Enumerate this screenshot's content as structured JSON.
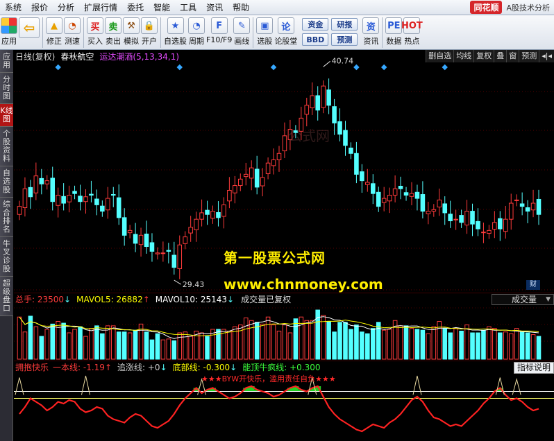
{
  "menu": [
    "系统",
    "报价",
    "分析",
    "扩展行情",
    "委托",
    "智能",
    "工具",
    "资讯",
    "帮助"
  ],
  "brand": {
    "logo": "同花顺",
    "title": "A股技术分析"
  },
  "toolbar": {
    "items": [
      {
        "label": "应用",
        "icon": "app-grid-icon"
      },
      {
        "label": "",
        "icon": "back-arrow-icon"
      },
      {
        "label": "修正",
        "icon": "correct-icon"
      },
      {
        "label": "测速",
        "icon": "speed-test-icon"
      },
      {
        "label": "买入",
        "icon": "buy-icon"
      },
      {
        "label": "卖出",
        "icon": "sell-icon"
      },
      {
        "label": "模拟",
        "icon": "simulate-icon"
      },
      {
        "label": "开户",
        "icon": "lock-icon"
      },
      {
        "label": "自选股",
        "icon": "star-icon"
      },
      {
        "label": "周期",
        "icon": "clock-icon"
      },
      {
        "label": "F10/F9",
        "icon": "f10-icon"
      },
      {
        "label": "画线",
        "icon": "draw-icon"
      },
      {
        "label": "选股",
        "icon": "select-stock-icon"
      },
      {
        "label": "论股堂",
        "icon": "forum-icon"
      },
      {
        "label": "资讯",
        "icon": "news-icon"
      },
      {
        "label": "数据",
        "icon": "data-icon"
      },
      {
        "label": "热点",
        "icon": "hot-icon"
      }
    ],
    "small": [
      "资金",
      "研报",
      "BBD",
      "预测"
    ],
    "icon_glyphs": {
      "up": "▲",
      "down": "▼",
      "buy": "买",
      "sell": "卖",
      "lock": "🔒",
      "star": "★",
      "clock": "◔",
      "draw": "✎",
      "pe": "PE",
      "hot": "HOT",
      "info": "资"
    }
  },
  "left_tabs": [
    "应用",
    "分时图",
    "K线图",
    "个股资料",
    "自选股",
    "综合排名",
    "牛叉诊股",
    "超级盘口"
  ],
  "chart_header": {
    "period": "日线(复权)",
    "stock": "春秋航空",
    "indicator": "运达潮酒(5,13,34,1)"
  },
  "right_controls": [
    "删自选",
    "均线",
    "复权",
    "叠",
    "窗",
    "预测"
  ],
  "price": {
    "high": "40.74",
    "low": "29.43"
  },
  "cai_label": "财",
  "volume_header": {
    "total": "总手: 23500",
    "mavol5": "MAVOL5: 26882",
    "mavol10": "MAVOL10: 25143",
    "adj": "成交量已复权",
    "selector": "成交量"
  },
  "indicator_header": {
    "name": "拥抱快乐",
    "l1": "一本线: -1.19",
    "l2": "追涨线: +0",
    "l3": "底部线: -0.300",
    "l4": "能顶牛疯线: +0.300",
    "explain": "指标说明"
  },
  "watermark": {
    "line1": "第一股票公式网",
    "line2": "www.chnmoney.com",
    "faint": "公式网"
  },
  "warning_text": "★★★BYW开快乐，滥用责任自负★★★",
  "colors": {
    "up": "#ff3b3b",
    "down": "#54ffff",
    "yellow": "#ffff00",
    "ma": "#e8e8e8"
  },
  "chart_data": [
    {
      "type": "candlestick",
      "title": "春秋航空 日线(复权)",
      "ylim": [
        28,
        42
      ],
      "annotations": [
        {
          "label": "40.74",
          "kind": "high"
        },
        {
          "label": "29.43",
          "kind": "low"
        }
      ],
      "close": [
        33.2,
        34.3,
        33.8,
        35.1,
        34.6,
        34.8,
        33.5,
        33.9,
        33.4,
        33.9,
        34.0,
        33.5,
        33.8,
        33.9,
        33.3,
        32.9,
        33.7,
        33.9,
        32.5,
        31.4,
        31.7,
        30.9,
        31.4,
        30.7,
        30.4,
        30.3,
        30.3,
        30.4,
        29.4,
        30.8,
        31.3,
        31.9,
        32.4,
        32.8,
        32.7,
        32.9,
        32.5,
        33.3,
        34.2,
        34.5,
        34.9,
        35.2,
        35.6,
        34.4,
        35.0,
        35.9,
        36.1,
        36.5,
        37.6,
        38.0,
        37.8,
        38.7,
        39.5,
        40.1,
        39.2,
        40.7,
        39.5,
        38.4,
        37.7,
        37.0,
        36.5,
        35.2,
        34.8,
        34.7,
        34.0,
        33.2,
        33.7,
        33.9,
        34.3,
        34.3,
        33.9,
        34.0,
        33.7,
        32.9,
        32.9,
        33.0,
        33.6,
        32.8,
        32.3,
        32.4,
        32.2,
        32.9,
        32.1,
        31.8,
        31.6,
        31.7,
        32.2,
        31.8,
        32.4,
        33.4,
        33.6,
        33.2,
        32.9,
        33.4,
        32.7
      ]
    },
    {
      "type": "bar",
      "title": "成交量",
      "series": [
        {
          "name": "总手",
          "values": [
            48,
            31,
            49,
            37,
            26,
            34,
            40,
            43,
            41,
            30,
            34,
            37,
            26,
            35,
            38,
            29,
            38,
            38,
            31,
            31,
            30,
            33,
            40,
            31,
            22,
            29,
            22,
            23,
            21,
            30,
            31,
            26,
            32,
            30,
            26,
            34,
            34,
            34,
            32,
            37,
            39,
            47,
            44,
            42,
            40,
            48,
            39,
            32,
            39,
            30,
            46,
            48,
            44,
            44,
            56,
            50,
            43,
            31,
            42,
            42,
            34,
            39,
            31,
            29,
            35,
            42,
            33,
            34,
            44,
            38,
            38,
            35,
            34,
            33,
            29,
            37,
            43,
            35,
            30,
            35,
            32,
            39,
            30,
            30,
            33,
            37,
            35,
            30,
            31,
            29,
            35,
            31,
            30,
            28,
            26
          ]
        }
      ]
    },
    {
      "type": "line",
      "title": "拥抱快乐",
      "series": [
        {
          "name": "",
          "values": [
            -0.6,
            -0.2,
            0.3,
            0.1,
            -0.1,
            -0.4,
            -0.2,
            0.1,
            0.0,
            0.2,
            0.1,
            -0.3,
            -0.5,
            -0.4,
            -0.2,
            -0.3,
            -0.7,
            -0.9,
            -1.0,
            -1.1,
            -0.8,
            -0.6,
            -0.7,
            -1.0,
            -1.3,
            -1.4,
            -1.2,
            -1.0,
            -0.6,
            -0.1,
            0.3,
            0.6,
            0.9,
            0.6,
            0.8,
            0.9,
            0.7,
            0.5,
            0.3,
            0.4,
            0.6,
            0.9,
            1.0,
            0.8,
            0.7,
            0.6,
            0.4,
            0.5,
            0.7,
            0.9,
            1.0,
            0.8,
            0.7,
            0.9,
            1.0,
            0.4,
            -0.2,
            -0.6,
            -0.9,
            -1.1,
            -1.3,
            -1.5,
            -1.6,
            -1.4,
            -1.2,
            -1.3,
            -1.4,
            -1.1,
            -0.9,
            -0.6,
            -0.2,
            0.2,
            0.4,
            0.1,
            -0.4,
            -0.8,
            -0.9,
            -1.1,
            -1.3,
            -1.2,
            -1.3,
            -1.0,
            -0.7,
            -0.4,
            0.0,
            0.3,
            0.7,
            0.9,
            0.5,
            0.2,
            0.3,
            0.1,
            -0.2,
            -0.4,
            -0.3
          ]
        }
      ]
    }
  ]
}
